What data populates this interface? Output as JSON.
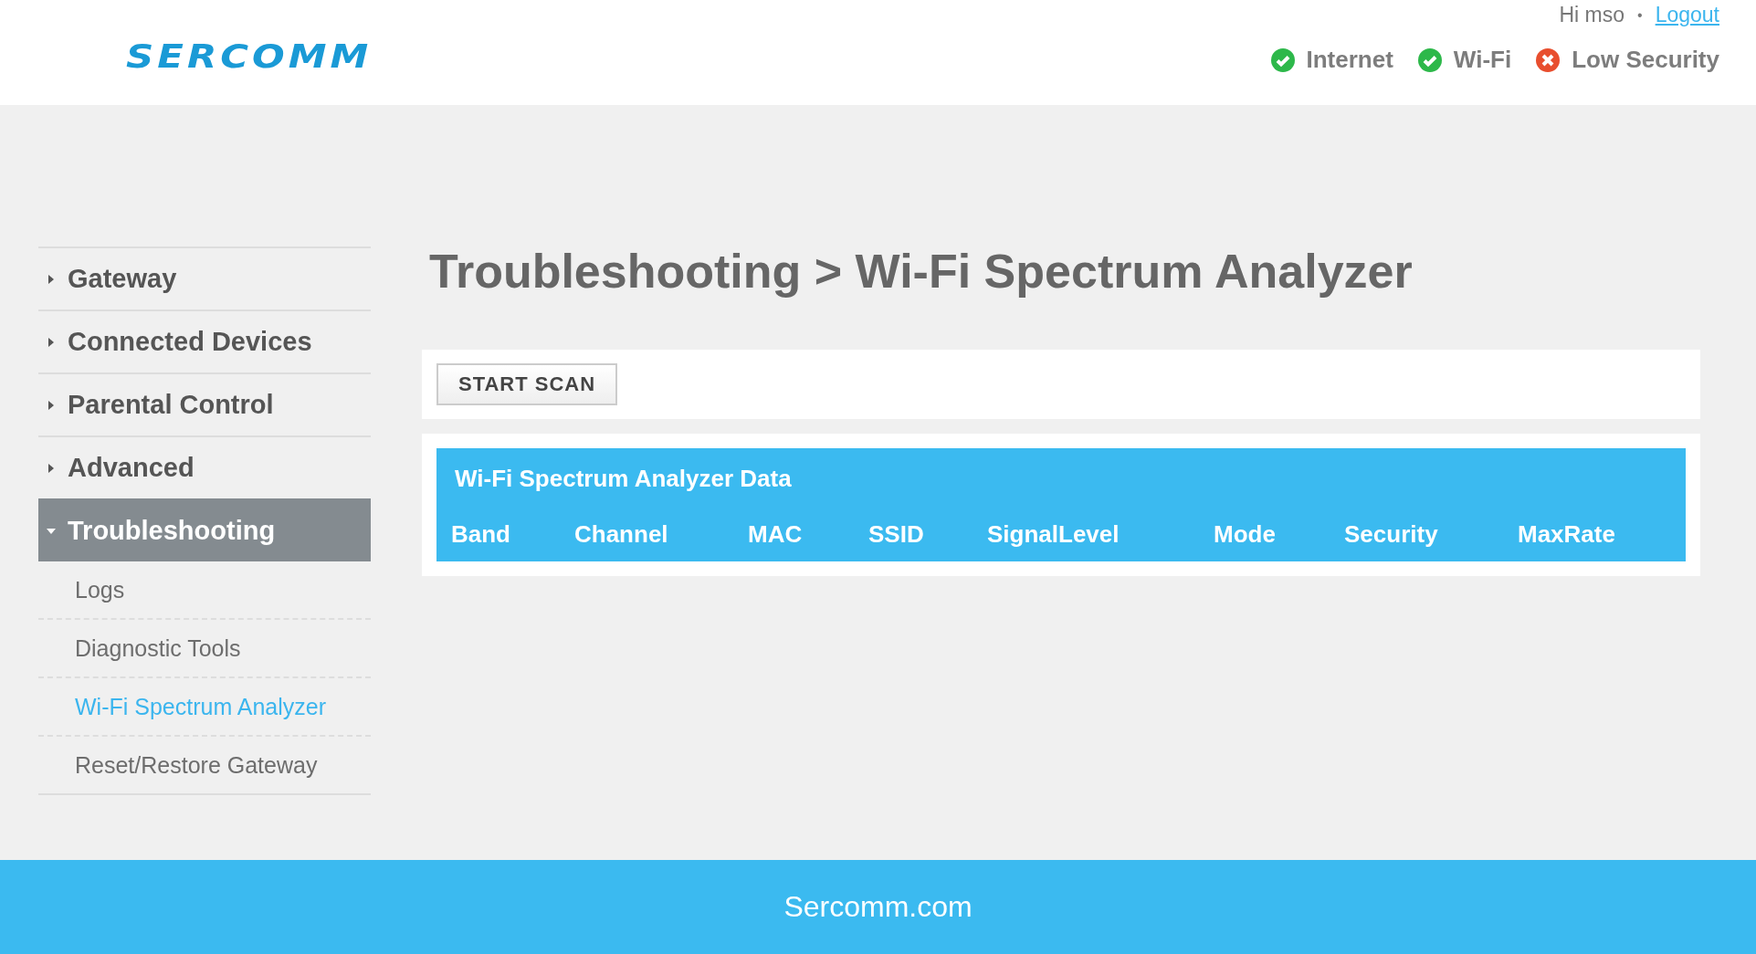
{
  "header": {
    "logo": "SERCOMM",
    "greeting": "Hi mso",
    "separator": "•",
    "logout": "Logout",
    "status": [
      {
        "label": "Internet",
        "ok": true
      },
      {
        "label": "Wi-Fi",
        "ok": true
      },
      {
        "label": "Low Security",
        "ok": false
      }
    ]
  },
  "sidebar": {
    "items": [
      {
        "label": "Gateway",
        "expanded": false,
        "selected": false
      },
      {
        "label": "Connected Devices",
        "expanded": false,
        "selected": false
      },
      {
        "label": "Parental Control",
        "expanded": false,
        "selected": false
      },
      {
        "label": "Advanced",
        "expanded": false,
        "selected": false
      },
      {
        "label": "Troubleshooting",
        "expanded": true,
        "selected": true,
        "children": [
          {
            "label": "Logs",
            "selected": false
          },
          {
            "label": "Diagnostic Tools",
            "selected": false
          },
          {
            "label": "Wi-Fi Spectrum Analyzer",
            "selected": true
          },
          {
            "label": "Reset/Restore Gateway",
            "selected": false
          }
        ]
      }
    ]
  },
  "page_title": "Troubleshooting > Wi-Fi Spectrum Analyzer",
  "scan_button": "START SCAN",
  "table": {
    "title": "Wi-Fi Spectrum Analyzer Data",
    "columns": [
      "Band",
      "Channel",
      "MAC",
      "SSID",
      "SignalLevel",
      "Mode",
      "Security",
      "MaxRate"
    ]
  },
  "footer": "Sercomm.com"
}
